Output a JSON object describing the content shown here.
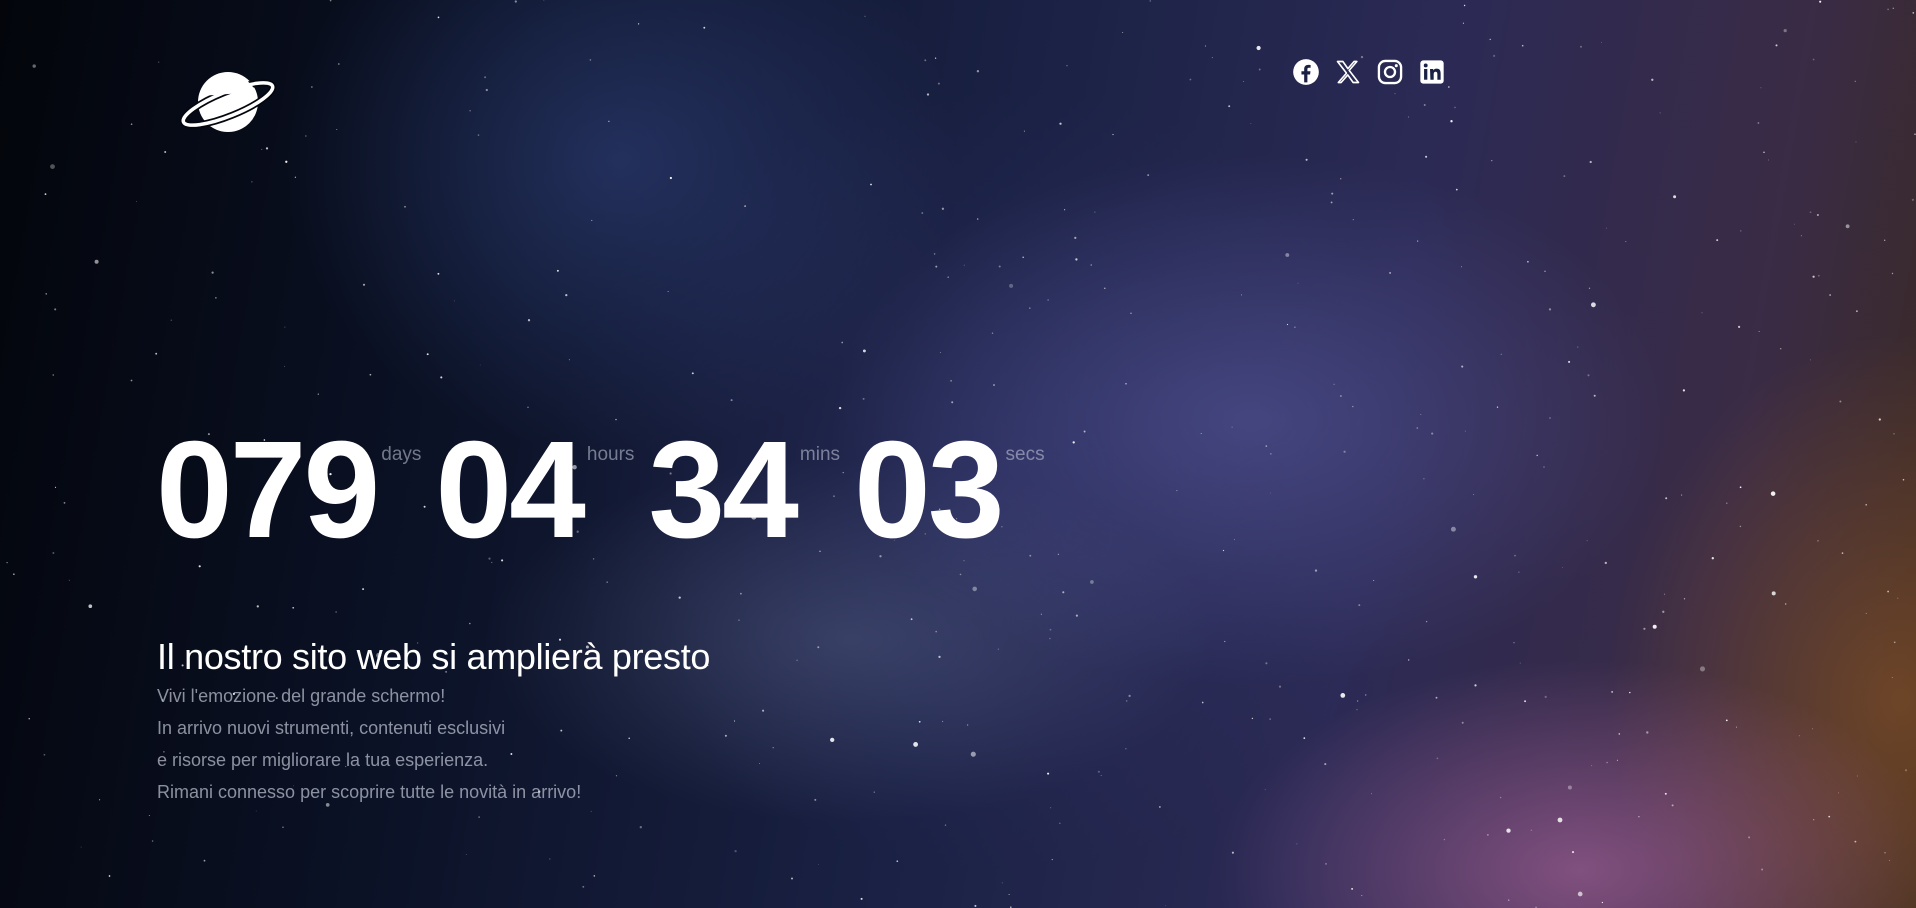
{
  "brand": {
    "logo_icon": "saturn-planet-icon"
  },
  "social": [
    {
      "name": "facebook",
      "icon": "facebook-icon"
    },
    {
      "name": "x",
      "icon": "x-twitter-icon"
    },
    {
      "name": "instagram",
      "icon": "instagram-icon"
    },
    {
      "name": "linkedin",
      "icon": "linkedin-icon"
    }
  ],
  "countdown": {
    "days": {
      "value": "079",
      "label": "days"
    },
    "hours": {
      "value": "04",
      "label": "hours"
    },
    "mins": {
      "value": "34",
      "label": "mins"
    },
    "secs": {
      "value": "03",
      "label": "secs"
    }
  },
  "hero": {
    "headline": "Il nostro sito web si amplierà presto",
    "lines": [
      "Vivi l'emozione del grande schermo!",
      "In arrivo nuovi strumenti, contenuti esclusivi",
      "e risorse per migliorare la tua esperienza.",
      "Rimani connesso per scoprire tutte le novità in arrivo!"
    ]
  },
  "colors": {
    "text_primary": "#ffffff",
    "text_muted": "#bec3d2",
    "background_dark": "#05070f"
  }
}
